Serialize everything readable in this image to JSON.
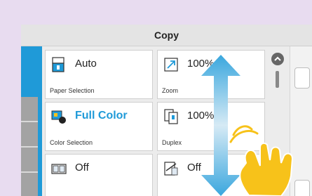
{
  "window": {
    "title": "Copy"
  },
  "tiles": [
    {
      "value": "Auto",
      "label": "Paper Selection",
      "icon": "paper-tray-icon"
    },
    {
      "value": "100%",
      "label": "Zoom",
      "icon": "zoom-icon"
    },
    {
      "value": "Full Color",
      "label": "Color Selection",
      "icon": "color-selection-icon"
    },
    {
      "value": "100%",
      "label": "Duplex",
      "icon": "duplex-icon"
    },
    {
      "value": "Off",
      "label": "",
      "icon": "combine-icon"
    },
    {
      "value": "Off",
      "label": "",
      "icon": "staple-icon"
    }
  ],
  "colors": {
    "accent": "#1f9ad8",
    "background": "#e8dcf0",
    "hand": "#f7c21a"
  },
  "gesture": {
    "icon": "swipe-hand-icon",
    "direction": "vertical"
  }
}
